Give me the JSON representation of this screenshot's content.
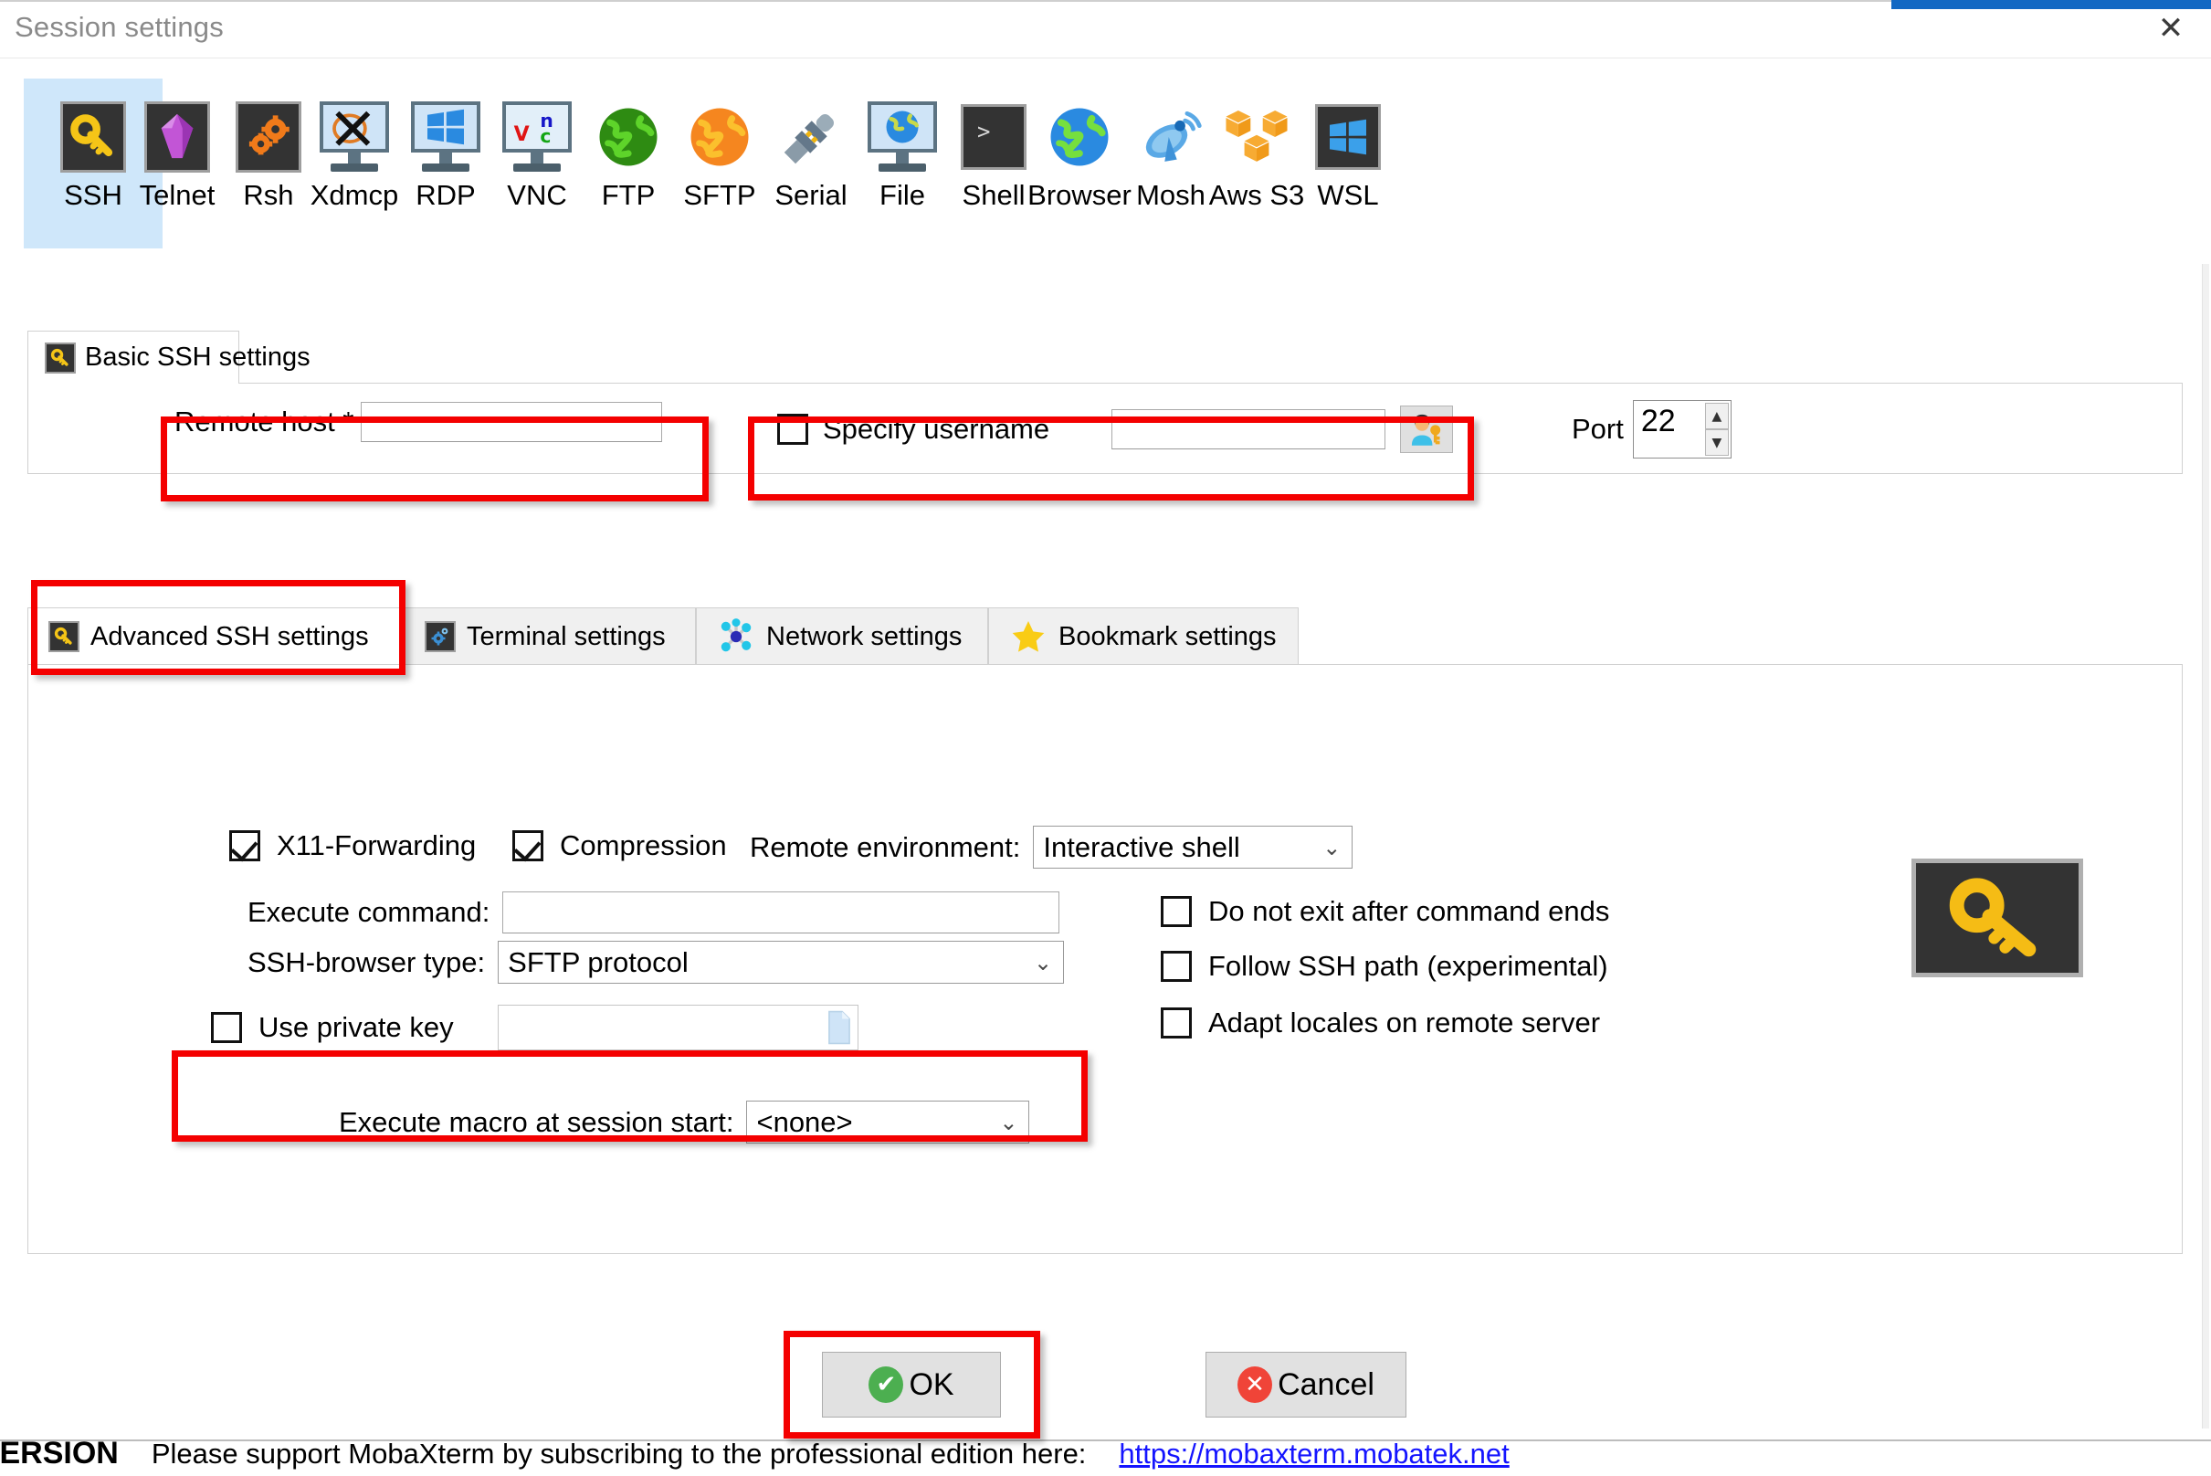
{
  "window": {
    "title": "Session settings",
    "close_label": "✕"
  },
  "protocols": [
    {
      "label": "SSH",
      "icon": "key-icon",
      "selected": true
    },
    {
      "label": "Telnet",
      "icon": "gem-icon",
      "selected": false
    },
    {
      "label": "Rsh",
      "icon": "gears-icon",
      "selected": false
    },
    {
      "label": "Xdmcp",
      "icon": "x-monitor-icon",
      "selected": false
    },
    {
      "label": "RDP",
      "icon": "windows-monitor-icon",
      "selected": false
    },
    {
      "label": "VNC",
      "icon": "vnc-monitor-icon",
      "selected": false
    },
    {
      "label": "FTP",
      "icon": "green-globe-icon",
      "selected": false
    },
    {
      "label": "SFTP",
      "icon": "orange-globe-icon",
      "selected": false
    },
    {
      "label": "Serial",
      "icon": "plug-icon",
      "selected": false
    },
    {
      "label": "File",
      "icon": "globe-monitor-icon",
      "selected": false
    },
    {
      "label": "Shell",
      "icon": "terminal-icon",
      "selected": false
    },
    {
      "label": "Browser",
      "icon": "blue-globe-icon",
      "selected": false
    },
    {
      "label": "Mosh",
      "icon": "satellite-icon",
      "selected": false
    },
    {
      "label": "Aws S3",
      "icon": "aws-cubes-icon",
      "selected": false
    },
    {
      "label": "WSL",
      "icon": "wsl-windows-icon",
      "selected": false
    }
  ],
  "basic": {
    "tab_label": "Basic SSH settings",
    "remote_host_label": "Remote host *",
    "remote_host_value": "",
    "remote_host_placeholder": "",
    "specify_username_label": "Specify username",
    "specify_username_checked": false,
    "username_value": "",
    "username_placeholder": "",
    "user_picker_icon": "user-key-icon",
    "port_label": "Port",
    "port_value": "22"
  },
  "tabs": [
    {
      "label": "Advanced SSH settings",
      "icon": "key-icon",
      "active": true
    },
    {
      "label": "Terminal settings",
      "icon": "gear-blue-icon",
      "active": false
    },
    {
      "label": "Network settings",
      "icon": "network-icon",
      "active": false
    },
    {
      "label": "Bookmark settings",
      "icon": "star-icon",
      "active": false
    }
  ],
  "advanced": {
    "x11_label": "X11-Forwarding",
    "x11_checked": true,
    "compression_label": "Compression",
    "compression_checked": true,
    "remote_env_label": "Remote environment:",
    "remote_env_value": "Interactive shell",
    "execute_command_label": "Execute command:",
    "execute_command_value": "",
    "execute_command_placeholder": "",
    "ssh_browser_label": "SSH-browser type:",
    "ssh_browser_value": "SFTP protocol",
    "use_private_key_label": "Use private key",
    "use_private_key_checked": false,
    "private_key_value": "",
    "private_key_placeholder": "",
    "private_key_browse_icon": "file-browse-icon",
    "no_exit_label": "Do not exit after command ends",
    "no_exit_checked": false,
    "follow_path_label": "Follow SSH path (experimental)",
    "follow_path_checked": false,
    "adapt_locales_label": "Adapt locales on remote server",
    "adapt_locales_checked": false,
    "macro_label": "Execute macro at session start:",
    "macro_value": "<none>",
    "side_icon": "key-icon"
  },
  "buttons": {
    "ok_label": "OK",
    "ok_icon": "check-circle-icon",
    "cancel_label": "Cancel",
    "cancel_icon": "x-circle-icon"
  },
  "status": {
    "registered": "ISTERED VERSION",
    "message": "Please support MobaXterm by subscribing to the professional edition here:",
    "link": "https://mobaxterm.mobatek.net"
  },
  "colors": {
    "annotation": "#f40000",
    "selection": "#cfe7fa",
    "link": "#1414ff"
  }
}
